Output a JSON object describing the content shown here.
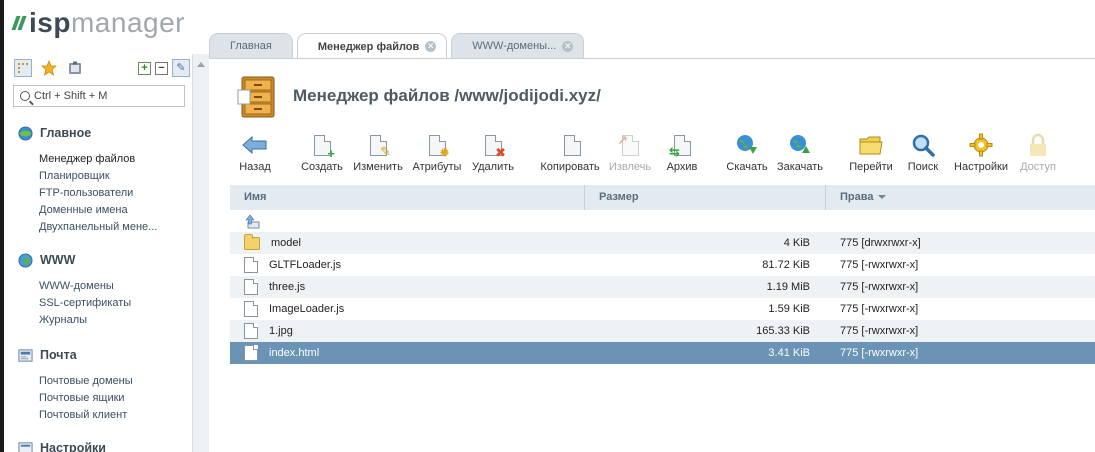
{
  "brand": {
    "isp": "isp",
    "manager": "manager"
  },
  "tabs": [
    {
      "label": "Главная",
      "active": false,
      "closable": false
    },
    {
      "label": "Менеджер файлов",
      "active": true,
      "closable": true
    },
    {
      "label": "WWW-домены...",
      "active": false,
      "closable": true
    }
  ],
  "sidebar": {
    "search_placeholder": "Ctrl + Shift + M",
    "sections": [
      {
        "title": "Главное",
        "icon": "home-globe-icon",
        "items": [
          "Менеджер файлов",
          "Планировщик",
          "FTP-пользователи",
          "Доменные имена",
          "Двухпанельный мене..."
        ]
      },
      {
        "title": "WWW",
        "icon": "www-globe-icon",
        "items": [
          "WWW-домены",
          "SSL-сертификаты",
          "Журналы"
        ]
      },
      {
        "title": "Почта",
        "icon": "mail-icon",
        "items": [
          "Почтовые домены",
          "Почтовые ящики",
          "Почтовый клиент"
        ]
      },
      {
        "title": "Настройки",
        "icon": "settings-icon",
        "items": []
      }
    ]
  },
  "main": {
    "title": "Менеджер файлов /www/jodijodi.xyz/",
    "toolbar": [
      {
        "label": "Назад",
        "icon": "back-arrow-icon",
        "enabled": true
      },
      {
        "label": "Создать",
        "icon": "create-file-icon",
        "enabled": true
      },
      {
        "label": "Изменить",
        "icon": "edit-file-icon",
        "enabled": true
      },
      {
        "label": "Атрибуты",
        "icon": "attributes-icon",
        "enabled": true
      },
      {
        "label": "Удалить",
        "icon": "delete-file-icon",
        "enabled": true
      },
      {
        "label": "Копировать",
        "icon": "copy-icon",
        "enabled": true
      },
      {
        "label": "Извлечь",
        "icon": "extract-icon",
        "enabled": false
      },
      {
        "label": "Архив",
        "icon": "archive-icon",
        "enabled": true
      },
      {
        "label": "Скачать",
        "icon": "download-icon",
        "enabled": true
      },
      {
        "label": "Закачать",
        "icon": "upload-icon",
        "enabled": true
      },
      {
        "label": "Перейти",
        "icon": "goto-folder-icon",
        "enabled": true
      },
      {
        "label": "Поиск",
        "icon": "search-icon",
        "enabled": true
      },
      {
        "label": "Настройки",
        "icon": "settings-gear-icon",
        "enabled": true
      },
      {
        "label": "Доступ",
        "icon": "lock-icon",
        "enabled": false
      }
    ],
    "table": {
      "columns": {
        "name": "Имя",
        "size": "Размер",
        "perms": "Права"
      },
      "rows": [
        {
          "name": "",
          "size": "",
          "perms": "",
          "type": "up"
        },
        {
          "name": "model",
          "size": "4 KiB",
          "perms": "775 [drwxrwxr-x]",
          "type": "folder"
        },
        {
          "name": "GLTFLoader.js",
          "size": "81.72 KiB",
          "perms": "775 [-rwxrwxr-x]",
          "type": "file"
        },
        {
          "name": "three.js",
          "size": "1.19 MiB",
          "perms": "775 [-rwxrwxr-x]",
          "type": "file"
        },
        {
          "name": "ImageLoader.js",
          "size": "1.59 KiB",
          "perms": "775 [-rwxrwxr-x]",
          "type": "file"
        },
        {
          "name": "1.jpg",
          "size": "165.33 KiB",
          "perms": "775 [-rwxrwxr-x]",
          "type": "file"
        },
        {
          "name": "index.html",
          "size": "3.41 KiB",
          "perms": "775 [-rwxrwxr-x]",
          "type": "file",
          "selected": true
        }
      ]
    }
  }
}
